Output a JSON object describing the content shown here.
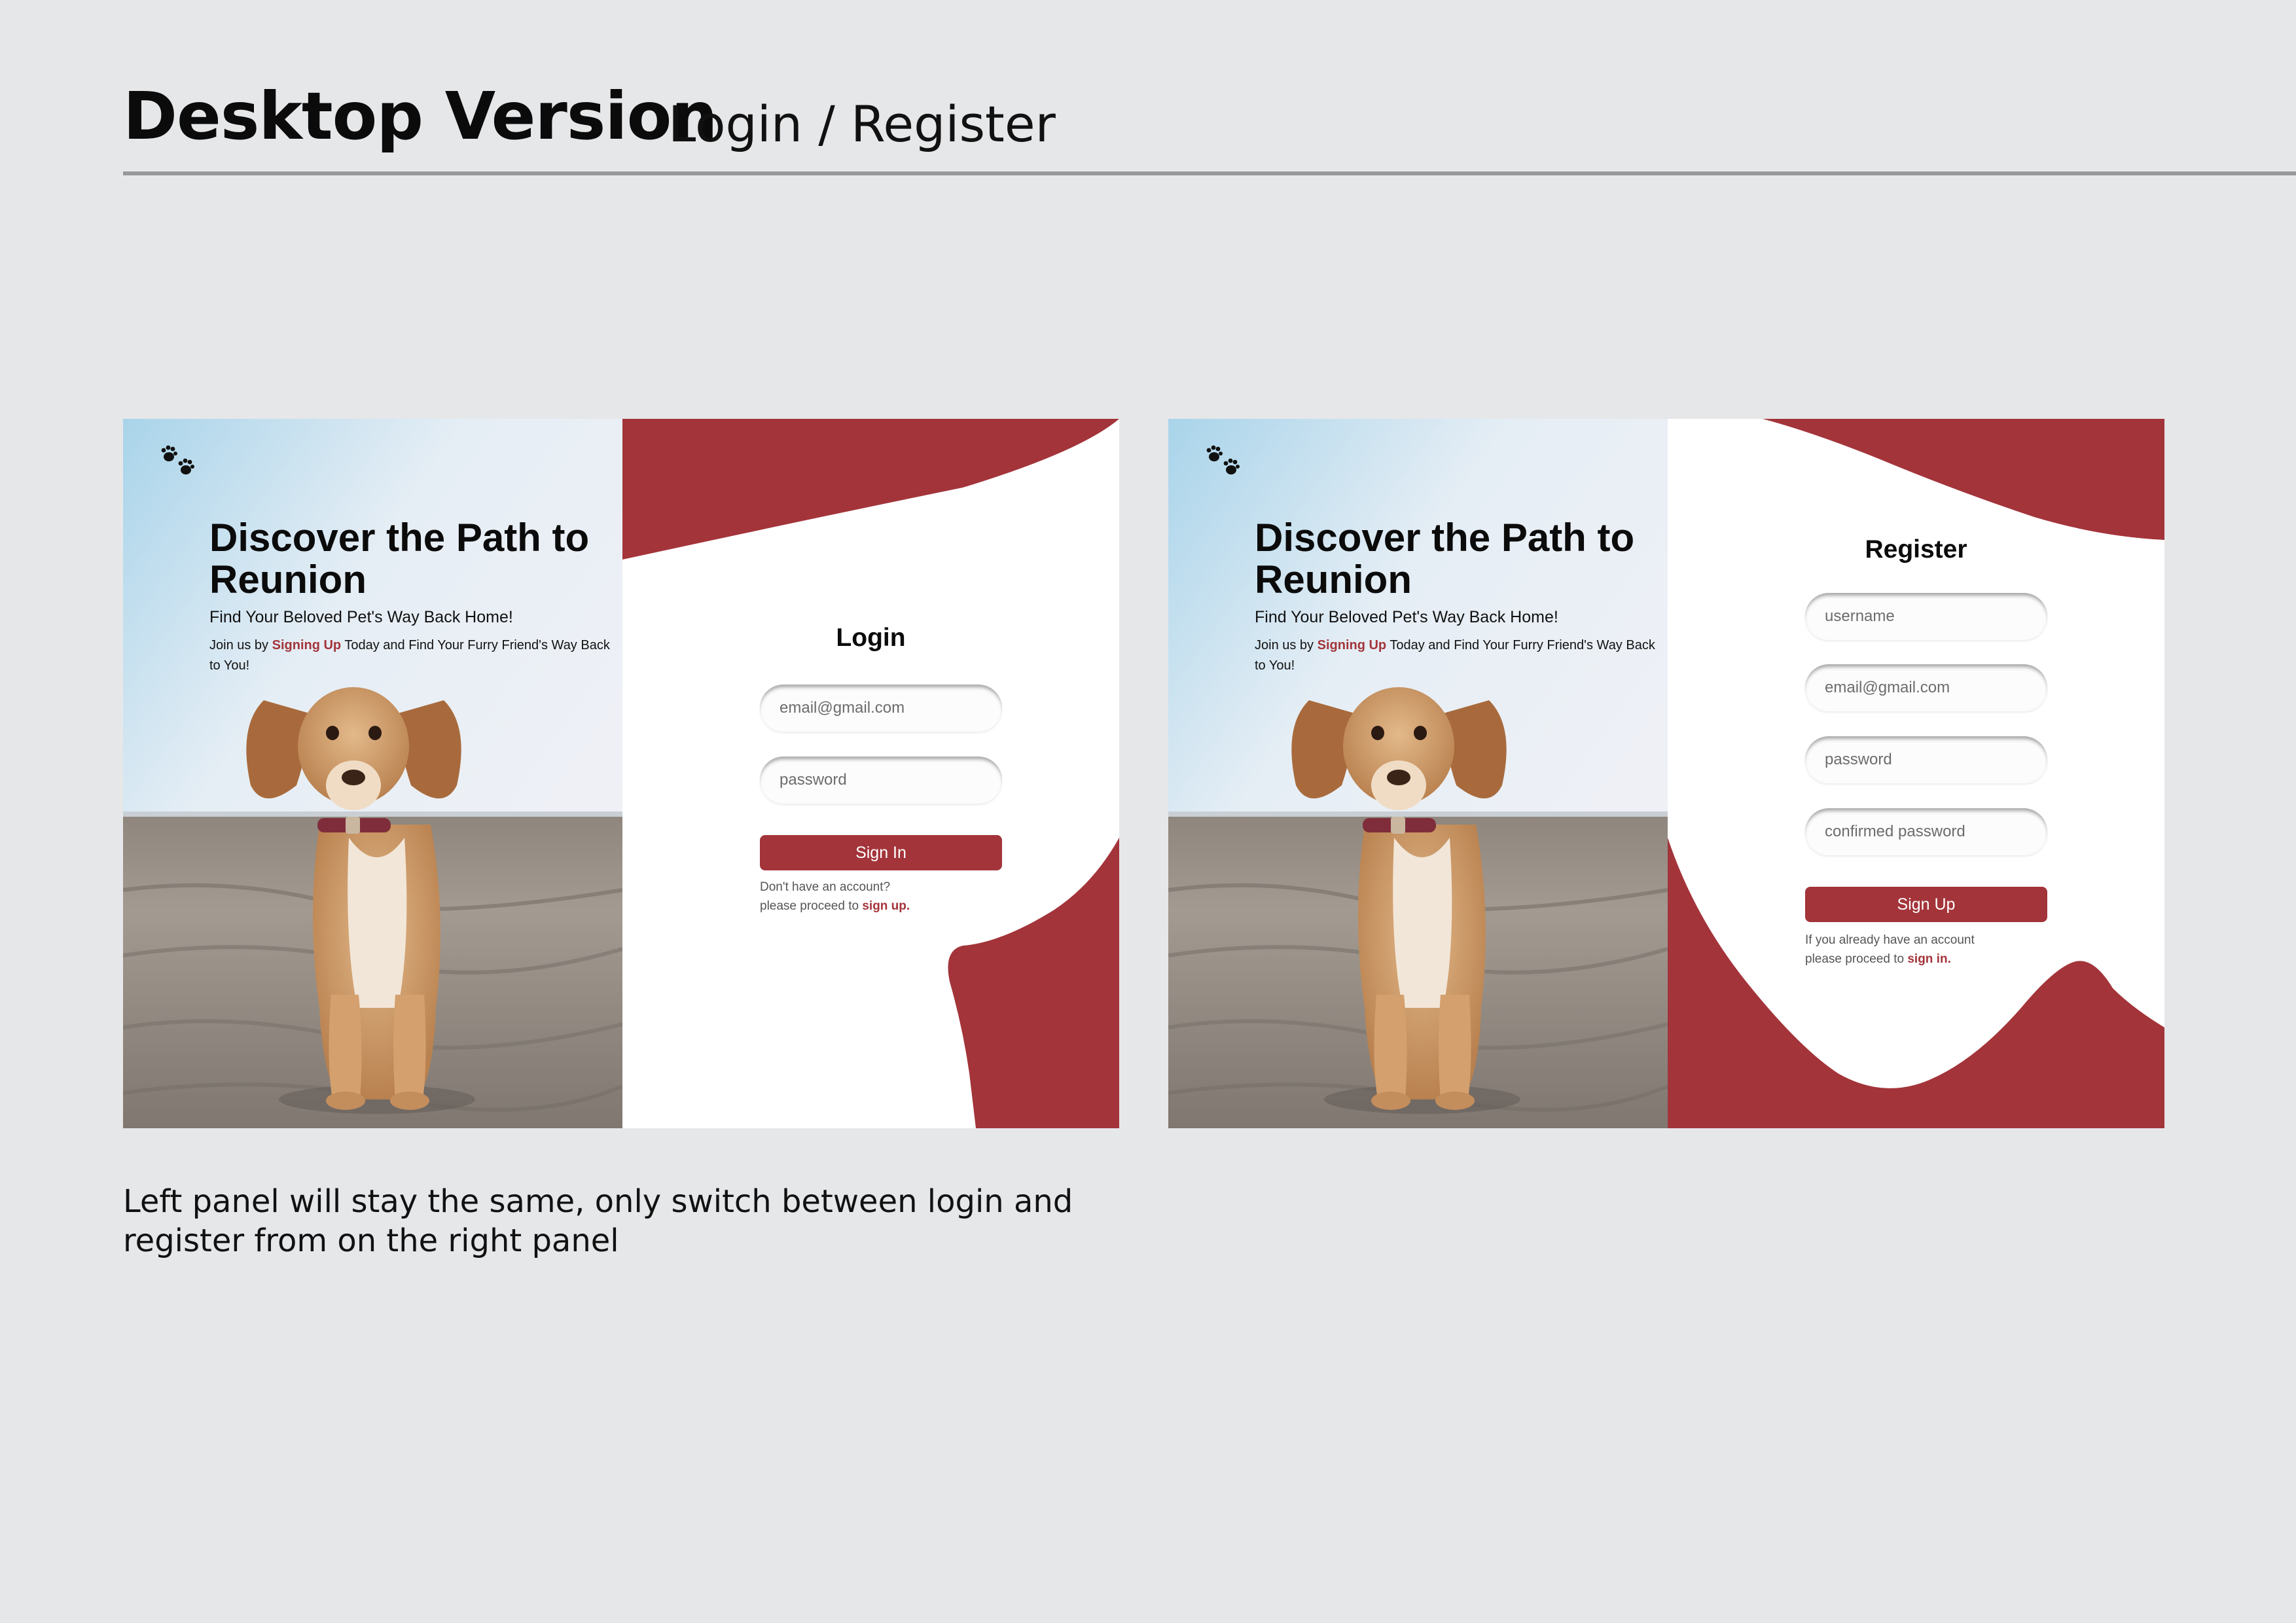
{
  "header": {
    "title": "Desktop Version",
    "subtitle": "Login / Register"
  },
  "hero": {
    "title": "Discover the Path to Reunion",
    "subtitle": "Find Your Beloved Pet's Way Back Home!",
    "desc_prefix": "Join us by ",
    "desc_accent": "Signing Up",
    "desc_suffix": " Today and Find Your Furry Friend's Way Back to You!"
  },
  "login": {
    "title": "Login",
    "email_placeholder": "email@gmail.com",
    "password_placeholder": "password",
    "button": "Sign In",
    "hint_line1": "Don't have an account?",
    "hint_line2_prefix": "please proceed to ",
    "hint_link": "sign up."
  },
  "register": {
    "title": "Register",
    "username_placeholder": "username",
    "email_placeholder": "email@gmail.com",
    "password_placeholder": "password",
    "confirm_placeholder": "confirmed password",
    "button": "Sign Up",
    "hint_line1": "If you already have an account",
    "hint_line2_prefix": "please proceed to ",
    "hint_link": "sign in."
  },
  "caption": "Left panel will stay the same, only switch between login and register from on the right panel",
  "colors": {
    "accent": "#a3343a",
    "background": "#e6e7e9"
  },
  "icons": {
    "logo": "paw-prints-icon",
    "hero_image": "dog-on-beach-photo"
  }
}
